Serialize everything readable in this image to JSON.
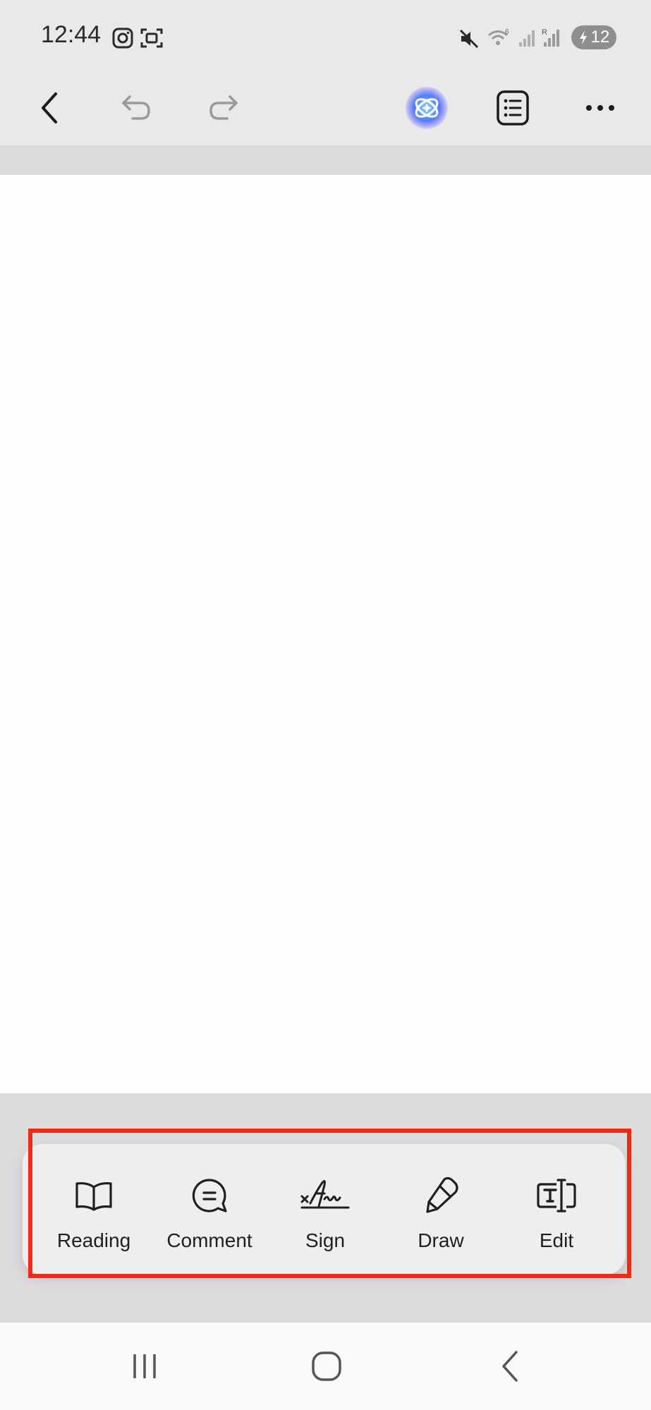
{
  "status_bar": {
    "time": "12:44",
    "battery_level": "12",
    "icons": [
      "instagram-icon",
      "screenshot-icon",
      "mute-icon",
      "wifi-icon",
      "signal-icon",
      "roaming-signal-icon",
      "battery-charging-icon"
    ]
  },
  "toolbar": {
    "icons": [
      "back-arrow-icon",
      "undo-icon",
      "redo-icon",
      "ai-assistant-icon",
      "outline-list-icon",
      "more-options-icon"
    ]
  },
  "tools": [
    {
      "label": "Reading",
      "icon": "book-icon"
    },
    {
      "label": "Comment",
      "icon": "comment-bubble-icon"
    },
    {
      "label": "Sign",
      "icon": "signature-icon"
    },
    {
      "label": "Draw",
      "icon": "pen-icon"
    },
    {
      "label": "Edit",
      "icon": "text-edit-icon"
    }
  ],
  "colors": {
    "highlight": "#f22a12",
    "ai_gradient_start": "#6a5cff",
    "ai_gradient_end": "#2ab8ff"
  },
  "nav_bar": {
    "icons": [
      "recent-apps-icon",
      "home-icon",
      "nav-back-icon"
    ]
  }
}
